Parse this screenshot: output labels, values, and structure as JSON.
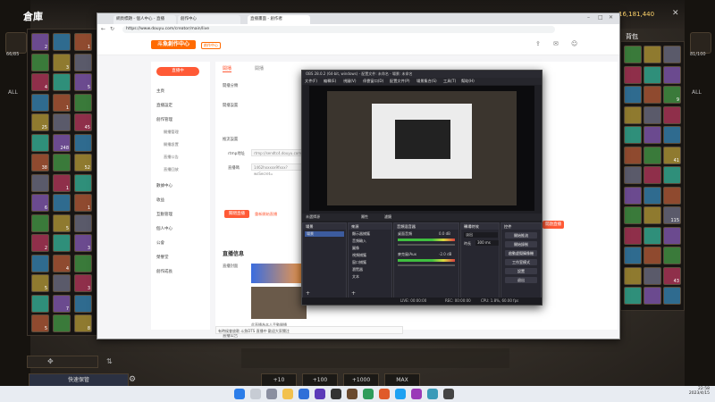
{
  "game": {
    "left_title": "倉庫",
    "left_capacity": "66/85",
    "right_title": "背包",
    "right_capacity": "81/100",
    "currency": "16,181,440",
    "all_label": "ALL",
    "left_counts": [
      "2",
      "1",
      "3",
      "4",
      "5",
      "1",
      "25",
      "45",
      "248",
      "38",
      "52",
      "1",
      "6",
      "1",
      "5",
      "2",
      "3",
      "4",
      "5",
      "3",
      "7",
      "5",
      "8",
      "4"
    ],
    "right_counts": [
      "9",
      "41",
      "115",
      "43"
    ],
    "quick_store": "快速保管",
    "amount_buttons": [
      "+10",
      "+100",
      "+1000",
      "MAX"
    ]
  },
  "browser": {
    "tabs": [
      "網頁標題 - 個人中心 - 直播",
      "創作中心",
      "直播畫面 - 創作者"
    ],
    "url": "https://www.douyu.com/creator/main/live",
    "logo": "斗魚創作中心",
    "logo_badge": "創作中心",
    "live_button": "直播中",
    "tabs_content": [
      "開播",
      "開播"
    ],
    "nav": [
      "主頁",
      "直播設定",
      "創作管理",
      "數據中心",
      "收益",
      "互動管理",
      "個人中心",
      "公會",
      "榮譽堂",
      "創作成長"
    ],
    "nav_sub": [
      "開播管理",
      "開播設置",
      "直播公告",
      "直播回放"
    ],
    "form_labels": [
      "開播分類",
      "開播設置",
      "推流設置"
    ],
    "rtmp_label": "rtmp地址",
    "rtmp_value": "rtmp://sendtc4.douyu.com/live",
    "key_label": "直播碼",
    "key_value": "1462hxxxxx9fxxx?wsSecret=",
    "close_live": "關閉直播",
    "restart_live": "重新開始直播",
    "live_info_title": "直播信息",
    "cover_label": "直播封面",
    "notice_label": "直播公告",
    "notice_value": "有時候會放歌 斗魚DTS 直播中 歡迎大家關注",
    "side_btn": "開啟直播",
    "note_text": "此直播為本人手動開播"
  },
  "obs": {
    "title": "OBS 28.0.2 (64-bit, windows) - 配置文件: 未命名 - 場景: 未命名",
    "menu": [
      "文件(F)",
      "編輯(E)",
      "視圖(V)",
      "停靠窗口(D)",
      "配置文件(P)",
      "場景集合(S)",
      "工具(T)",
      "幫助(H)"
    ],
    "preview_label": "未選擇源",
    "preview_btns": [
      "屬性",
      "濾鏡"
    ],
    "docks": {
      "scenes": "場景",
      "sources": "來源",
      "mixer": "音頻混音器",
      "transitions": "轉場特效",
      "controls": "控件"
    },
    "scene_items": [
      "場景"
    ],
    "source_items": [
      "顯示器捕獲",
      "音頻輸入",
      "圖像",
      "視頻捕獲",
      "窗口捕獲",
      "瀏覽器",
      "文本"
    ],
    "mixer_items": [
      "桌面音頻",
      "麥克風/Aux"
    ],
    "mixer_levels": [
      "0.0 dB",
      "-2.0 dB"
    ],
    "transition": "淡出",
    "duration_label": "時長",
    "duration": "300 ms",
    "control_buttons": [
      "開始推流",
      "開始錄制",
      "啟動虛擬攝像機",
      "工作室模式",
      "設置",
      "退出"
    ],
    "status": [
      "LIVE: 00:00:00",
      "REC: 00:00:00",
      "CPU: 1.8%, 60.00 fps"
    ]
  },
  "taskbar": {
    "time": "22:58",
    "date": "2023/4/15"
  },
  "colors": {
    "accent": "#ff5a36",
    "obs_bg": "#1f1f24"
  }
}
